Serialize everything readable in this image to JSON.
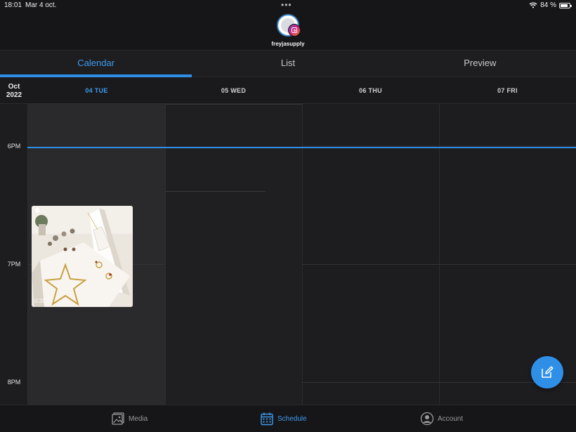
{
  "status_bar": {
    "time": "18:01",
    "date": "Mar 4 oct.",
    "battery": "84 %",
    "battery_level": 0.84
  },
  "profile": {
    "handle": "freyjasupply",
    "network_icon": "instagram-icon"
  },
  "tabs": [
    {
      "label": "Calendar",
      "active": true
    },
    {
      "label": "List",
      "active": false
    },
    {
      "label": "Preview",
      "active": false
    }
  ],
  "calendar": {
    "month": "Oct",
    "year": "2022",
    "days": [
      {
        "label": "04 TUE",
        "today": true
      },
      {
        "label": "05 WED",
        "today": false
      },
      {
        "label": "06 THU",
        "today": false
      },
      {
        "label": "07 FRI",
        "today": false
      }
    ],
    "hours": [
      "6PM",
      "7PM",
      "8PM"
    ],
    "scheduled_post": {
      "day": "04 TUE",
      "type_icon": "video-icon",
      "duration": "0:30"
    }
  },
  "bottom_nav": [
    {
      "label": "Media",
      "icon": "image-icon",
      "active": false
    },
    {
      "label": "Schedule",
      "icon": "calendar-icon",
      "active": true
    },
    {
      "label": "Account",
      "icon": "user-circle-icon",
      "active": false
    }
  ],
  "colors": {
    "accent": "#2f8fe6",
    "background": "#161618",
    "today_column": "#2a2a2d"
  }
}
